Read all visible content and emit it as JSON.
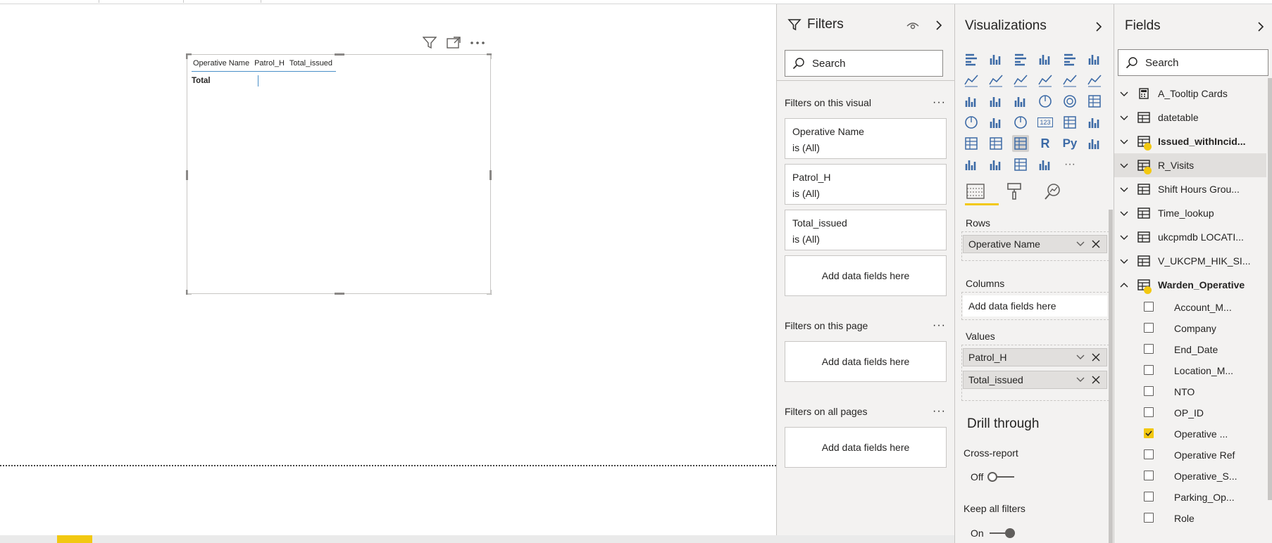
{
  "visual": {
    "columns": [
      "Operative Name",
      "Patrol_H",
      "Total_issued"
    ],
    "total_label": "Total"
  },
  "filters": {
    "title": "Filters",
    "search_placeholder": "Search",
    "on_visual": {
      "label": "Filters on this visual",
      "cards": [
        {
          "name": "Operative Name",
          "state": "is (All)"
        },
        {
          "name": "Patrol_H",
          "state": "is (All)"
        },
        {
          "name": "Total_issued",
          "state": "is (All)"
        }
      ],
      "add_label": "Add data fields here"
    },
    "on_page": {
      "label": "Filters on this page",
      "add_label": "Add data fields here"
    },
    "on_all_pages": {
      "label": "Filters on all pages",
      "add_label": "Add data fields here"
    }
  },
  "visualizations": {
    "title": "Visualizations",
    "icon_names": [
      "stacked-bar-icon",
      "stacked-column-icon",
      "clustered-bar-icon",
      "clustered-column-icon",
      "100-stacked-bar-icon",
      "100-stacked-column-icon",
      "line-chart-icon",
      "area-chart-icon",
      "stacked-area-icon",
      "line-clustered-column-icon",
      "line-stacked-column-icon",
      "ribbon-chart-icon",
      "waterfall-icon",
      "funnel-icon",
      "scatter-icon",
      "pie-icon",
      "donut-icon",
      "treemap-icon",
      "map-icon",
      "filled-map-icon",
      "gauge-icon",
      "card-icon",
      "multi-row-card-icon",
      "kpi-icon",
      "slicer-icon",
      "table-icon",
      "matrix-icon",
      "r-visual-icon",
      "python-visual-icon",
      "key-influencers-icon",
      "decomposition-tree-icon",
      "qa-icon",
      "paginated-report-icon",
      "arcgis-icon",
      "more-visuals-icon"
    ],
    "glyphs": {
      "card": "123",
      "r": "R",
      "py": "Py",
      "more": "···"
    },
    "tabs": [
      "fields-tab-icon",
      "format-tab-icon",
      "analytics-tab-icon"
    ],
    "rows_label": "Rows",
    "rows": [
      "Operative Name"
    ],
    "columns_label": "Columns",
    "columns_add": "Add data fields here",
    "values_label": "Values",
    "values": [
      "Patrol_H",
      "Total_issued"
    ],
    "drill_title": "Drill through",
    "cross_report_label": "Cross-report",
    "cross_report_state": "Off",
    "keep_filters_label": "Keep all filters",
    "keep_filters_state": "On"
  },
  "fields_pane": {
    "title": "Fields",
    "search_placeholder": "Search",
    "tables": [
      {
        "name": "A_Tooltip Cards",
        "icon": "calculator-icon",
        "bold": false,
        "checked": false
      },
      {
        "name": "datetable",
        "icon": "table-icon",
        "bold": false,
        "checked": false
      },
      {
        "name": "Issued_withIncid...",
        "icon": "table-icon",
        "bold": true,
        "checked": true
      },
      {
        "name": "R_Visits",
        "icon": "table-icon",
        "bold": false,
        "checked": true
      },
      {
        "name": "Shift Hours Grou...",
        "icon": "table-icon",
        "bold": false,
        "checked": false
      },
      {
        "name": "Time_lookup",
        "icon": "table-icon",
        "bold": false,
        "checked": false
      },
      {
        "name": "ukcpmdb LOCATI...",
        "icon": "table-icon",
        "bold": false,
        "checked": false
      },
      {
        "name": "V_UKCPM_HIK_SI...",
        "icon": "table-icon",
        "bold": false,
        "checked": false
      },
      {
        "name": "Warden_Operative",
        "icon": "table-icon",
        "bold": true,
        "checked": true
      }
    ],
    "warden_fields": [
      {
        "name": "Account_M...",
        "checked": false
      },
      {
        "name": "Company",
        "checked": false
      },
      {
        "name": "End_Date",
        "checked": false
      },
      {
        "name": "Location_M...",
        "checked": false
      },
      {
        "name": "NTO",
        "checked": false
      },
      {
        "name": "OP_ID",
        "checked": false
      },
      {
        "name": "Operative ...",
        "checked": true
      },
      {
        "name": "Operative Ref",
        "checked": false
      },
      {
        "name": "Operative_S...",
        "checked": false
      },
      {
        "name": "Parking_Op...",
        "checked": false
      },
      {
        "name": "Role",
        "checked": false
      }
    ]
  },
  "colors": {
    "accent": "#f2c811",
    "pane_bg": "#f3f2f1",
    "icon_blue": "#3c6aa6"
  }
}
